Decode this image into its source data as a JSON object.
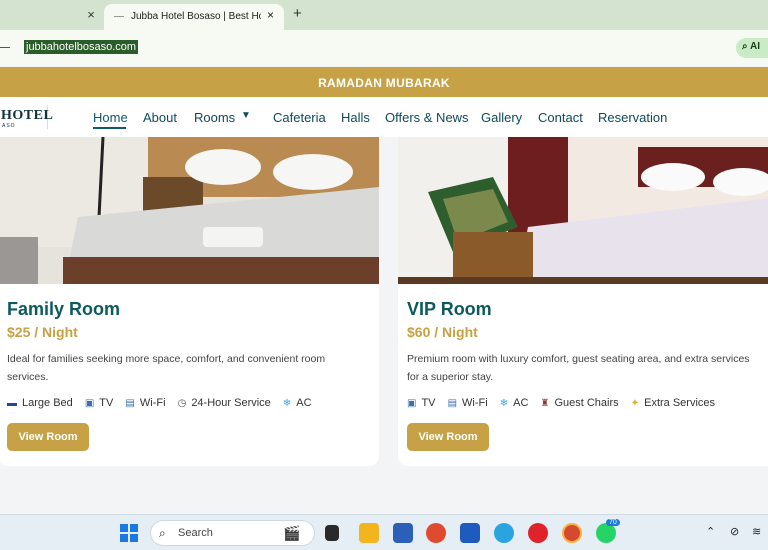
{
  "browser": {
    "prev_tab_close": "×",
    "active_tab_title": "Jubba Hotel Bosaso | Best Hotel",
    "tab_close": "×",
    "new_tab": "+",
    "url": "jubbahotelbosaso.com",
    "ai_label": "AI"
  },
  "site": {
    "banner": "RAMADAN MUBARAK",
    "logo_text": "HOTEL",
    "logo_sub": "ASO",
    "nav": [
      "Home",
      "About",
      "Rooms",
      "Cafeteria",
      "Halls",
      "Offers & News",
      "Gallery",
      "Contact",
      "Reservation"
    ],
    "nav_active": "Home"
  },
  "rooms": [
    {
      "name": "Family Room",
      "price": "$25 / Night",
      "description": "Ideal for families seeking more space, comfort, and convenient room services.",
      "amenities": [
        {
          "icon": "bed-icon",
          "label": "Large Bed"
        },
        {
          "icon": "tv-icon",
          "label": "TV"
        },
        {
          "icon": "wifi-icon",
          "label": "Wi-Fi"
        },
        {
          "icon": "clock-icon",
          "label": "24-Hour Service"
        },
        {
          "icon": "snowflake-icon",
          "label": "AC"
        }
      ],
      "button": "View Room"
    },
    {
      "name": "VIP Room",
      "price": "$60 / Night",
      "description": "Premium room with luxury comfort, guest seating area, and extra services for a superior stay.",
      "amenities": [
        {
          "icon": "tv-icon",
          "label": "TV"
        },
        {
          "icon": "wifi-icon",
          "label": "Wi-Fi"
        },
        {
          "icon": "snowflake-icon",
          "label": "AC"
        },
        {
          "icon": "chair-icon",
          "label": "Guest Chairs"
        },
        {
          "icon": "sparkle-icon",
          "label": "Extra Services"
        }
      ],
      "button": "View Room"
    }
  ],
  "taskbar": {
    "search_placeholder": "Search",
    "teams_badge": "70",
    "colors": {
      "accent": "#c6a145",
      "teal": "#0d5a5e"
    }
  }
}
